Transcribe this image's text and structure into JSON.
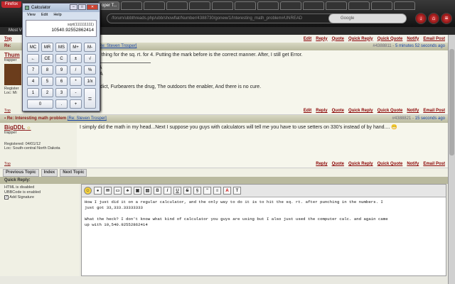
{
  "browser": {
    "menu_label": "Firefox",
    "tab_title": "oper T...",
    "url": "/forum/ubbthreads.php/ubb/showflat/Number/4388730/gonew/1/Interesting_math_problem#UNREAD",
    "search_engine": "Google",
    "bookmarks_item": "Most V"
  },
  "links_top": [
    "Top",
    "Edit",
    "Reply",
    "Quote",
    "Quick Reply",
    "Quick Quote",
    "Notify",
    "Email Post"
  ],
  "post1": {
    "header_subject": "Re:",
    "header_quote": "[Re: Steven Trosper]",
    "post_number": "#4388811",
    "time": "5 minutes 52 seconds ago",
    "author": "Thum",
    "author_title": "trapper",
    "reg_short": "Register",
    "loc_short": "Loc: Mi",
    "body_line1": "the same thing for the sq. rt. for 4. Putting the mark before is the correct manner. After, I still get Error.",
    "sig1": "mber NTA",
    "sig2": "mber NRA",
    "sig3": "r is an addict, Furbearers the drug, The outdoors the enabler, And there is no cure.",
    "actions": [
      "Edit",
      "Reply",
      "Quote",
      "Quick Reply",
      "Quick Quote",
      "Notify",
      "Email Post"
    ],
    "top": "Top"
  },
  "post2": {
    "header_subject": "Re: Interesting math problem",
    "header_quote": "[Re: Steven Trosper]",
    "post_number": "#4388821",
    "time": "15 seconds ago",
    "author": "BigDDL",
    "author_title": "trapper",
    "registered": "Registered: 04/01/12",
    "location": "Loc: South-central North Dakota",
    "body": "I simply did the math in my head...Next I suppose you guys with calculators will tell me you have to use setters on 330's instead of by hand.... 😁",
    "actions": [
      "Reply",
      "Quote",
      "Quick Reply",
      "Quick Quote",
      "Notify",
      "Email Post"
    ],
    "top": "Top"
  },
  "nav": [
    "Previous Topic",
    "Index",
    "Next Topic"
  ],
  "quick_reply": {
    "title": "Quick Reply:",
    "html_status": "HTML is disabled",
    "ubbcode_status": "UBBCode is enabled",
    "add_signature": "Add Signature",
    "text": "How I just did it on a regular calculator, and the only way to do it is to hit the sq. rt. after punching in the numbers. I\njust got 33,333.33333333\n\nWhat the heck? I don't know what kind of calculator you guys are using but I also just used the computer calc. and again came\nup with 10,540.92552862414",
    "toolbar": [
      "☺",
      "●",
      "✉",
      "▭",
      "♣",
      "▣",
      "▤",
      "B",
      "I",
      "U",
      "S",
      "§",
      "\"",
      "≡",
      "A",
      "T"
    ]
  },
  "calculator": {
    "title": "Calculator",
    "menu": [
      "View",
      "Edit",
      "Help"
    ],
    "expression": "sqrt(111111111)",
    "result": "10540.92552862414",
    "keys": [
      [
        "MC",
        "MR",
        "MS",
        "M+",
        "M-"
      ],
      [
        "←",
        "CE",
        "C",
        "±",
        "√"
      ],
      [
        "7",
        "8",
        "9",
        "/",
        "%"
      ],
      [
        "4",
        "5",
        "6",
        "*",
        "1/x"
      ],
      [
        "1",
        "2",
        "3",
        "-",
        ""
      ],
      [
        "0",
        "",
        ".",
        "+",
        ""
      ]
    ],
    "equals": "="
  }
}
